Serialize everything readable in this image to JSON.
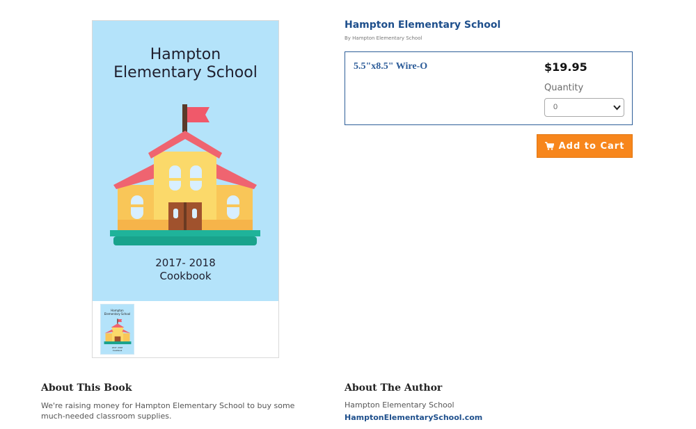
{
  "product": {
    "title": "Hampton Elementary School",
    "byline": "By Hampton Elementary School"
  },
  "cover": {
    "title_line1": "Hampton",
    "title_line2": "Elementary School",
    "sub_line1": "2017- 2018",
    "sub_line2": "Cookbook",
    "background": "#b4e3fa"
  },
  "option": {
    "format": "5.5\"x8.5\" Wire-O",
    "price": "$19.95",
    "quantity_label": "Quantity",
    "quantity_value": "0"
  },
  "cart": {
    "label": "Add to Cart",
    "icon": "cart-icon",
    "color": "#f7861c"
  },
  "about_book": {
    "heading": "About This Book",
    "text": "We're raising money for Hampton Elementary School to buy some much-needed classroom supplies."
  },
  "about_author": {
    "heading": "About The Author",
    "name": "Hampton Elementary School",
    "link": "HamptonElementarySchool.com"
  },
  "colors": {
    "link_blue": "#1e4f8c",
    "border_blue": "#2d5e98"
  }
}
